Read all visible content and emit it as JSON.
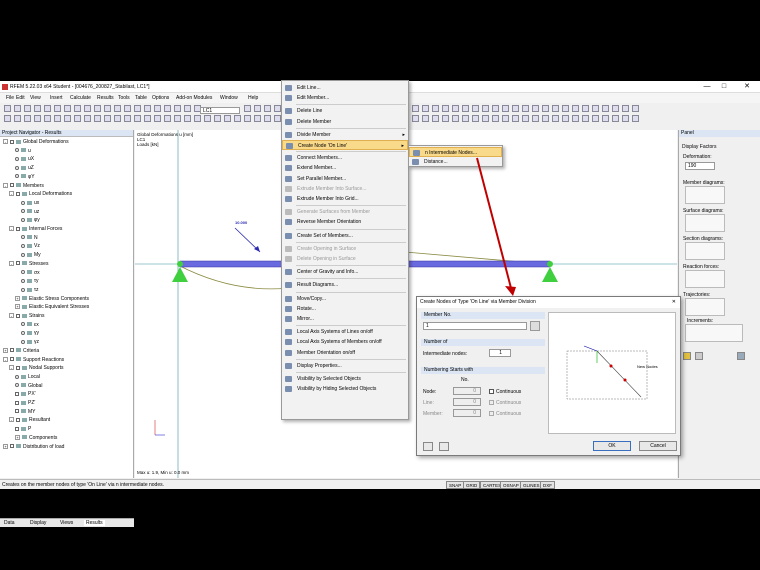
{
  "app": {
    "title": "RFEM 5.22.03 x64 Student - [004676_200827_Stabilast, LC1*]",
    "min": "—",
    "max": "□",
    "close": "✕"
  },
  "menu": [
    "File",
    "Edit",
    "View",
    "Insert",
    "Calculate",
    "Results",
    "Tools",
    "Table",
    "Options",
    "Add-on Modules",
    "Window",
    "Help"
  ],
  "loadcase": "LC1",
  "navigator": {
    "title": "Project Navigator - Results",
    "tabs": [
      "Data",
      "Display",
      "Views",
      "Results"
    ],
    "items": [
      {
        "t": "Global Deformations",
        "lvl": 0,
        "kind": "cb",
        "exp": "-"
      },
      {
        "t": "u",
        "lvl": 2,
        "kind": "rb"
      },
      {
        "t": "uX",
        "lvl": 2,
        "kind": "rb"
      },
      {
        "t": "uZ",
        "lvl": 2,
        "kind": "rb"
      },
      {
        "t": "φY",
        "lvl": 2,
        "kind": "rb"
      },
      {
        "t": "Members",
        "lvl": 0,
        "kind": "cb",
        "exp": "-"
      },
      {
        "t": "Local Deformations",
        "lvl": 1,
        "kind": "cb",
        "exp": "-"
      },
      {
        "t": "ux",
        "lvl": 3,
        "kind": "rb"
      },
      {
        "t": "uz",
        "lvl": 3,
        "kind": "rb"
      },
      {
        "t": "φy",
        "lvl": 3,
        "kind": "rb"
      },
      {
        "t": "Internal Forces",
        "lvl": 1,
        "kind": "cb",
        "exp": "-"
      },
      {
        "t": "N",
        "lvl": 3,
        "kind": "rb"
      },
      {
        "t": "Vz",
        "lvl": 3,
        "kind": "rb"
      },
      {
        "t": "My",
        "lvl": 3,
        "kind": "rb"
      },
      {
        "t": "Stresses",
        "lvl": 1,
        "kind": "cb",
        "exp": "-"
      },
      {
        "t": "σx",
        "lvl": 3,
        "kind": "rb"
      },
      {
        "t": "τy",
        "lvl": 3,
        "kind": "rb"
      },
      {
        "t": "τz",
        "lvl": 3,
        "kind": "rb"
      },
      {
        "t": "Elastic Stress Components",
        "lvl": 2,
        "kind": "none",
        "exp": "+"
      },
      {
        "t": "Elastic Equivalent Stresses",
        "lvl": 2,
        "kind": "none",
        "exp": "+"
      },
      {
        "t": "Strains",
        "lvl": 1,
        "kind": "cb",
        "exp": "-"
      },
      {
        "t": "εx",
        "lvl": 3,
        "kind": "rb"
      },
      {
        "t": "γy",
        "lvl": 3,
        "kind": "rb"
      },
      {
        "t": "γz",
        "lvl": 3,
        "kind": "rb"
      },
      {
        "t": "Criteria",
        "lvl": 0,
        "kind": "cb",
        "exp": "+"
      },
      {
        "t": "Support Reactions",
        "lvl": 0,
        "kind": "cb",
        "exp": "-"
      },
      {
        "t": "Nodal Supports",
        "lvl": 1,
        "kind": "cb",
        "exp": "-"
      },
      {
        "t": "Local",
        "lvl": 2,
        "kind": "rb"
      },
      {
        "t": "Global",
        "lvl": 2,
        "kind": "rb"
      },
      {
        "t": "PX'",
        "lvl": 2,
        "kind": "cb"
      },
      {
        "t": "PZ'",
        "lvl": 2,
        "kind": "cb"
      },
      {
        "t": "MY",
        "lvl": 2,
        "kind": "cb"
      },
      {
        "t": "Resultant",
        "lvl": 1,
        "kind": "cb",
        "exp": "-"
      },
      {
        "t": "P",
        "lvl": 2,
        "kind": "cb"
      },
      {
        "t": "Components",
        "lvl": 2,
        "kind": "none",
        "exp": "+"
      },
      {
        "t": "Distribution of load",
        "lvl": 0,
        "kind": "cb",
        "exp": "+"
      }
    ]
  },
  "canvas": {
    "info": [
      "Global Deformations u [mm]",
      "LC1",
      "Loads [kN]"
    ],
    "footer": "Max u: 1.9, Min u: 0.0 mm",
    "load_label": "10.000"
  },
  "context_menu": [
    {
      "t": "Edit Line...",
      "dis": false
    },
    {
      "t": "Edit Member...",
      "dis": false
    },
    {
      "sep": true
    },
    {
      "t": "Delete Line",
      "dis": false
    },
    {
      "t": "Delete Member",
      "dis": false
    },
    {
      "sep": true
    },
    {
      "t": "Divide Member",
      "dis": false,
      "arrow": true
    },
    {
      "t": "Create Node 'On Line'",
      "dis": false,
      "arrow": true,
      "hl": true
    },
    {
      "sep": true
    },
    {
      "t": "Connect Members...",
      "dis": false
    },
    {
      "t": "Extend Member...",
      "dis": false
    },
    {
      "t": "Set Parallel Member...",
      "dis": false
    },
    {
      "t": "Extrude Member Into Surface...",
      "dis": true
    },
    {
      "t": "Extrude Member Into Grid...",
      "dis": false
    },
    {
      "sep": true
    },
    {
      "t": "Generate Surfaces from Member",
      "dis": true
    },
    {
      "t": "Reverse Member Orientation",
      "dis": false
    },
    {
      "sep": true
    },
    {
      "t": "Create Set of Members...",
      "dis": false
    },
    {
      "sep": true
    },
    {
      "t": "Create Opening in Surface",
      "dis": true
    },
    {
      "t": "Delete Opening in Surface",
      "dis": true
    },
    {
      "sep": true
    },
    {
      "t": "Center of Gravity and Info...",
      "dis": false
    },
    {
      "sep": true
    },
    {
      "t": "Result Diagrams...",
      "dis": false
    },
    {
      "sep": true
    },
    {
      "t": "Move/Copy...",
      "dis": false
    },
    {
      "t": "Rotate...",
      "dis": false
    },
    {
      "t": "Mirror...",
      "dis": false
    },
    {
      "sep": true
    },
    {
      "t": "Local Axis Systems of Lines on/off",
      "dis": false
    },
    {
      "t": "Local Axis Systems of Members on/off",
      "dis": false
    },
    {
      "t": "Member Orientation on/off",
      "dis": false
    },
    {
      "sep": true
    },
    {
      "t": "Display Properties...",
      "dis": false
    },
    {
      "sep": true
    },
    {
      "t": "Visibility by Selected Objects",
      "dis": false
    },
    {
      "t": "Visibility by Hiding Selected Objects",
      "dis": false
    }
  ],
  "submenu": [
    "n Intermediate Nodes...",
    "Distance..."
  ],
  "dialog": {
    "title": "Create Nodes of Type 'On Line' via Member Division",
    "close": "✕",
    "member_group": "Member No.",
    "member_no": "1",
    "number_group": "Number of",
    "inter_label": "Intermediate nodes:",
    "inter_value": "1",
    "numbering_group": "Numbering Starts with",
    "no_header": "No.",
    "node_label": "Node:",
    "node_val": "0",
    "line_label": "Line:",
    "line_val": "0",
    "member_label": "Member:",
    "member_val": "0",
    "continuous": "Continuous",
    "preview_label": "New Nodes",
    "ok": "OK",
    "cancel": "Cancel"
  },
  "panel": {
    "title": "Panel",
    "section": "Display Factors",
    "deform_label": "Deformation:",
    "deform_value": "190",
    "member_diag": "Member diagrams:",
    "surface_diag": "Surface diagrams:",
    "section_diag": "Section diagrams:",
    "reaction": "Reaction forces:",
    "trajectories": "Trajectories:",
    "increments": "Increments:"
  },
  "status": {
    "text": "Creates on the member nodes of type 'On Line' via n intermediate nodes.",
    "buttons": [
      "SNAP",
      "GRID",
      "CARTES",
      "OSNAP",
      "GLINES",
      "DXF"
    ]
  }
}
